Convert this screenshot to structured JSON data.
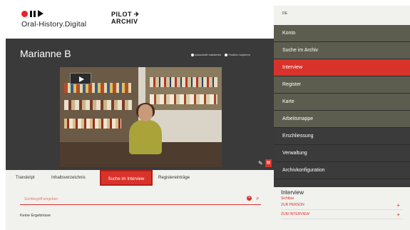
{
  "header": {
    "logo_text": "Oral-History.Digital",
    "pilot_line1": "PILOT",
    "pilot_line2": "ARCHIV",
    "plane_icon": "airplane-icon"
  },
  "interview": {
    "title": "Marianne B",
    "legend_marked": "Ausschnitt markieren",
    "legend_position": "Position kopieren"
  },
  "tabs": [
    {
      "label": "Transkript"
    },
    {
      "label": "Inhaltsverzeichnis"
    },
    {
      "label": "Suche im Interview"
    },
    {
      "label": "Registereinträge"
    }
  ],
  "search": {
    "placeholder": "Suchbegriff eingeben",
    "no_results": "Keine Ergebnisse"
  },
  "sidebar": {
    "language": "DE",
    "menu": [
      {
        "label": "Konto"
      },
      {
        "label": "Suche im Archiv"
      },
      {
        "label": "Interview"
      },
      {
        "label": "Register"
      },
      {
        "label": "Karte"
      },
      {
        "label": "Arbeitsmappe"
      },
      {
        "label": "Erschliessung"
      },
      {
        "label": "Verwaltung"
      },
      {
        "label": "Archivkonfiguration"
      }
    ],
    "panel": {
      "title": "Interview",
      "subtitle": "Sichtbar",
      "rows": [
        {
          "label": "ZUR PERSON"
        },
        {
          "label": "ZUM INTERVIEW"
        }
      ]
    }
  },
  "colors": {
    "accent": "#d8332b",
    "dark": "#3a3a3a",
    "olive": "#5d5d4f"
  }
}
